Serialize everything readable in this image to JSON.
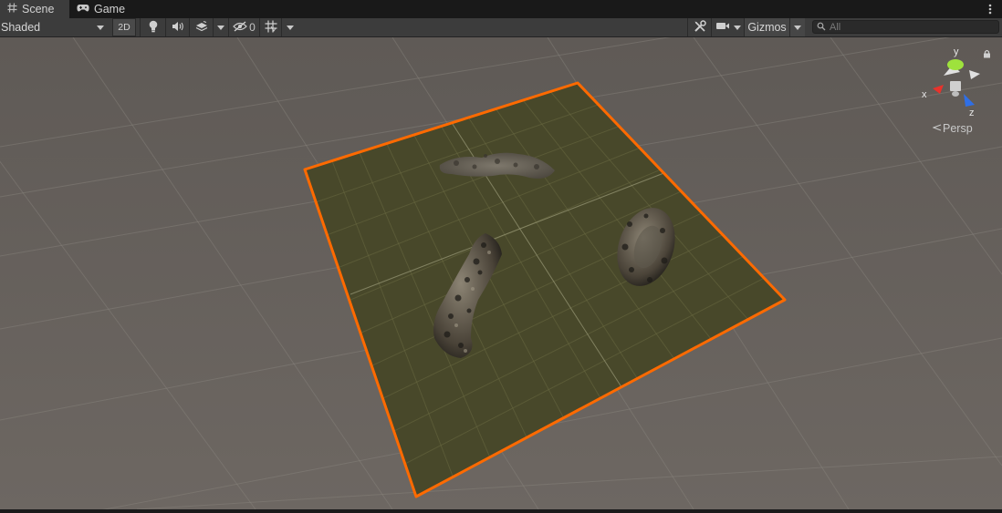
{
  "tabs": [
    {
      "label": "Scene",
      "icon": "hash-icon",
      "active": true
    },
    {
      "label": "Game",
      "icon": "gamepad-icon",
      "active": false
    }
  ],
  "toolbar": {
    "shading_mode": "Shaded",
    "mode_2d_label": "2D",
    "hidden_count": "0",
    "gizmos_label": "Gizmos",
    "search_placeholder": "All"
  },
  "viewport": {
    "projection_label": "Persp",
    "axis_x": "x",
    "axis_y": "y",
    "axis_z": "z"
  },
  "colors": {
    "background": "#6b6561",
    "plane": "#4a4a2a",
    "selection_outline": "#ff6a00",
    "axis_x": "#e8322b",
    "axis_y": "#9ee23c",
    "axis_z": "#2f6fe6"
  }
}
